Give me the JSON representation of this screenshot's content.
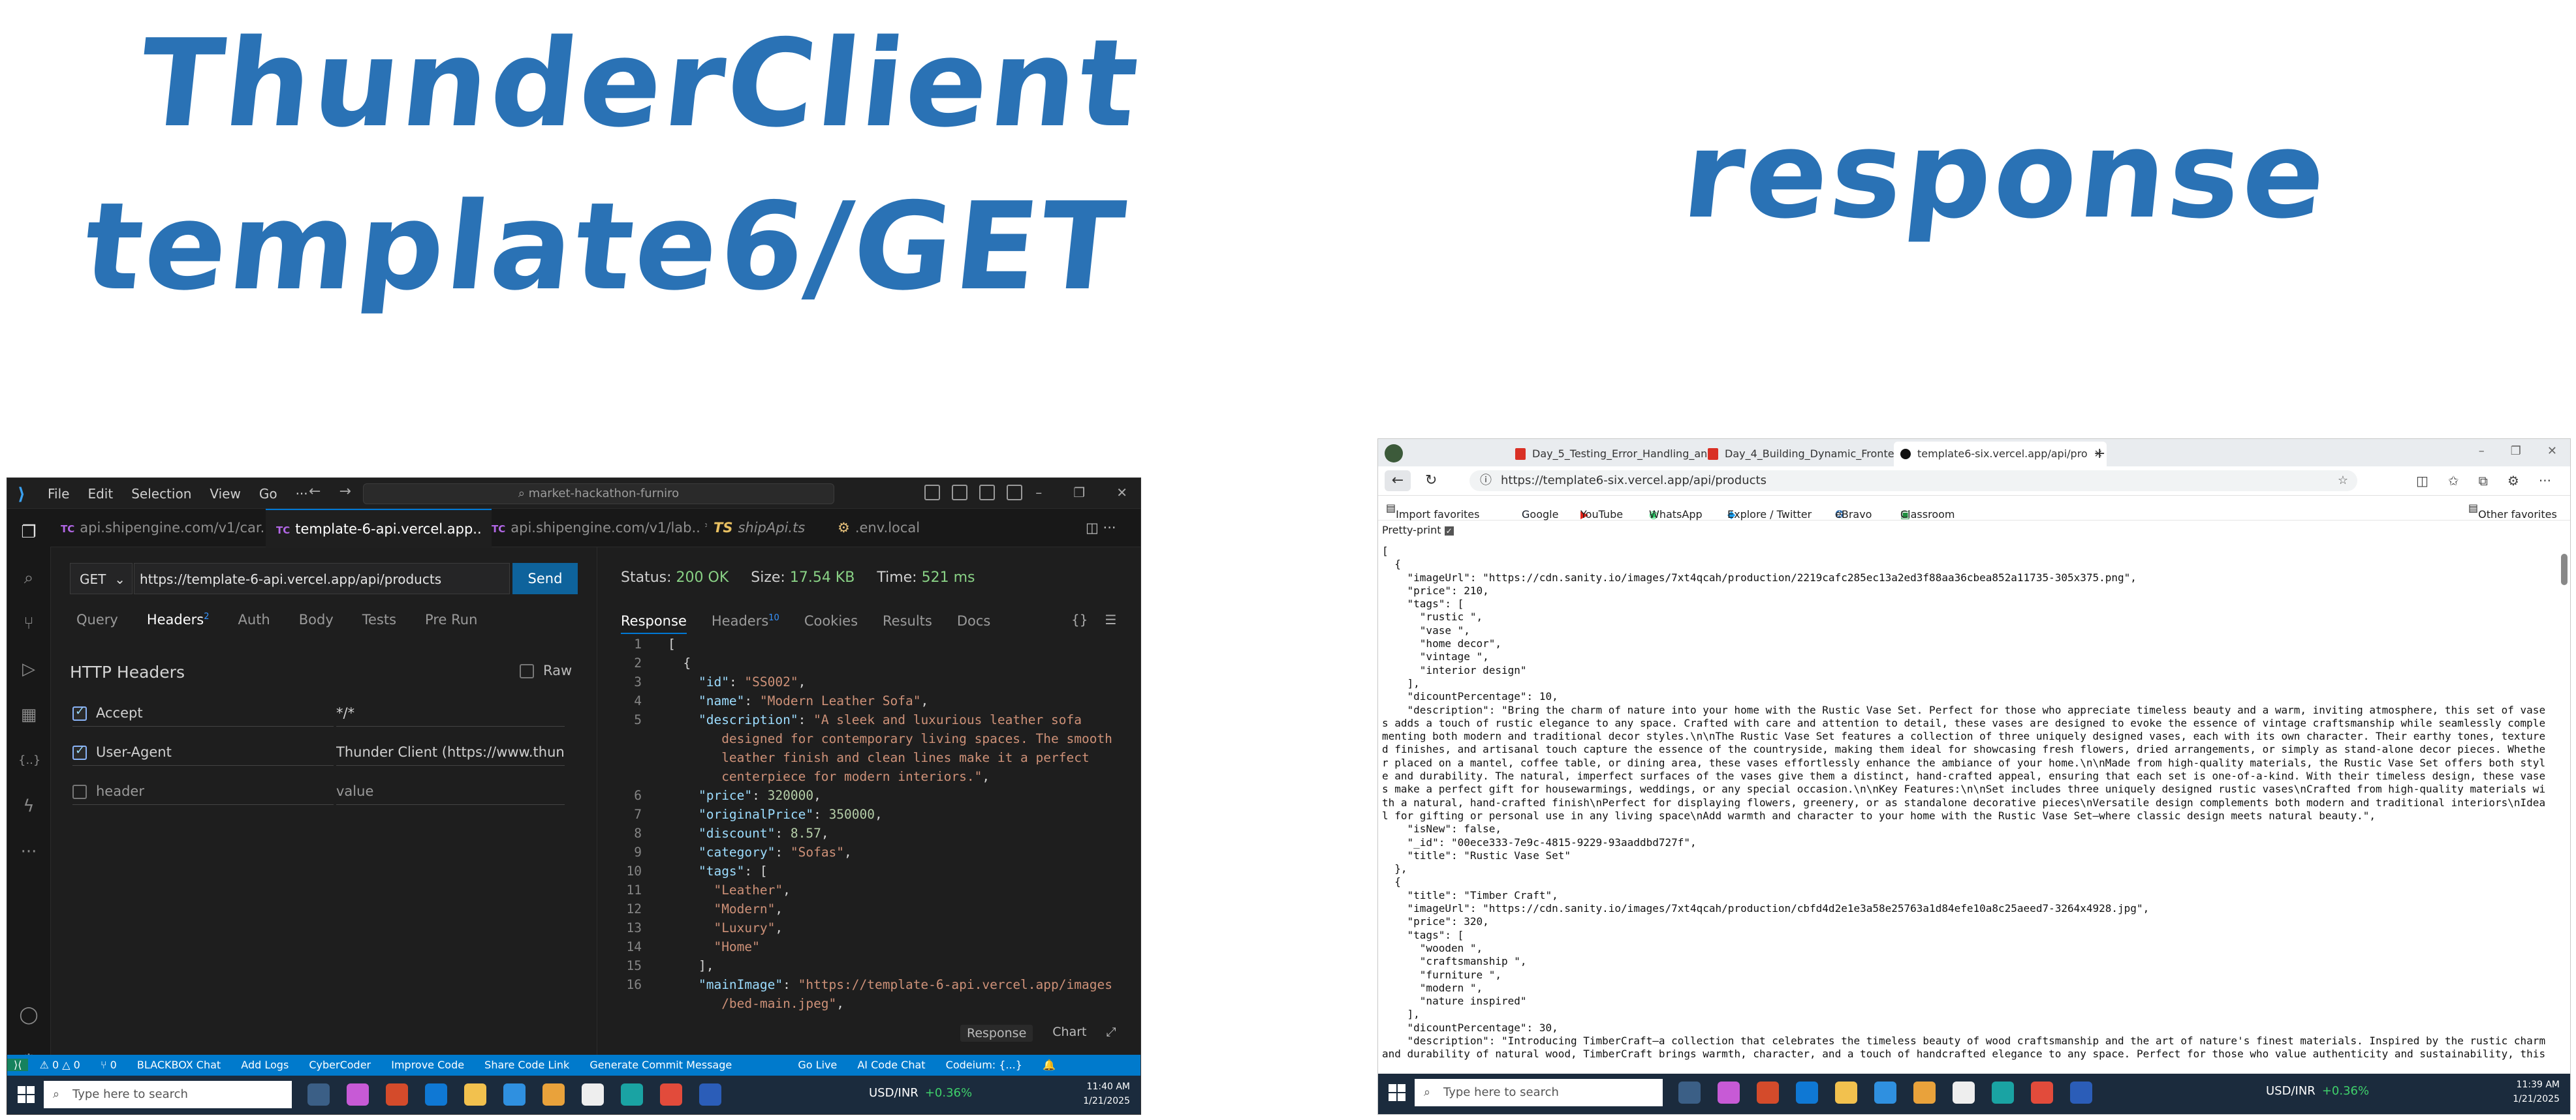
{
  "headings": {
    "left_line1": "ThunderClient",
    "left_line2": "template6/GET",
    "right": "response"
  },
  "vscode": {
    "menu": [
      "File",
      "Edit",
      "Selection",
      "View",
      "Go",
      "···"
    ],
    "search": "market-hackathon-furniro",
    "tabs": [
      {
        "label": "api.shipengine.com/v1/car...",
        "kind": "TC"
      },
      {
        "label": "template-6-api.vercel.app..",
        "kind": "TC",
        "active": true
      },
      {
        "label": "api.shipengine.com/v1/lab.. *",
        "kind": "TC"
      },
      {
        "label": "shipApi.ts",
        "kind": "TS"
      },
      {
        "label": ".env.local",
        "kind": "ENV"
      }
    ],
    "request": {
      "method": "GET",
      "url": "https://template-6-api.vercel.app/api/products",
      "send": "Send",
      "tabs": [
        "Query",
        "Headers",
        "Auth",
        "Body",
        "Tests",
        "Pre Run"
      ],
      "headers_count": "2",
      "section_title": "HTTP Headers",
      "raw_label": "Raw",
      "headers": [
        {
          "checked": true,
          "key": "Accept",
          "value": "*/*"
        },
        {
          "checked": true,
          "key": "User-Agent",
          "value": "Thunder Client (https://www.thunderclient"
        },
        {
          "checked": false,
          "key": "header",
          "value": "value"
        }
      ]
    },
    "response": {
      "status_label": "Status:",
      "status": "200 OK",
      "size_label": "Size:",
      "size": "17.54 KB",
      "time_label": "Time:",
      "time": "521 ms",
      "tabs": [
        "Response",
        "Headers",
        "Cookies",
        "Results",
        "Docs"
      ],
      "headers_count": "10",
      "braces": "{}",
      "footer": [
        "Response",
        "Chart"
      ]
    },
    "statusbar": [
      "⚠ 0 △ 0",
      "⑂ 0",
      "BLACKBOX Chat",
      "Add Logs",
      "CyberCoder",
      "Improve Code",
      "Share Code Link",
      "Generate Commit Message",
      "Go Live",
      "AI Code Chat",
      "Codeium: {...}"
    ],
    "taskbar": {
      "search": "Type here to search",
      "ticker": "USD/INR",
      "ticker_change": "+0.36%",
      "time": "11:40 AM",
      "date": "1/21/2025"
    }
  },
  "code_lines": [
    {
      "n": "1",
      "html": "<span class='pun'>[</span>"
    },
    {
      "n": "2",
      "html": "  <span class='pun'>{</span>"
    },
    {
      "n": "3",
      "html": "    <span class='key'>\"id\"</span>: <span class='str'>\"SS002\"</span>,"
    },
    {
      "n": "4",
      "html": "    <span class='key'>\"name\"</span>: <span class='str'>\"Modern Leather Sofa\"</span>,"
    },
    {
      "n": "5",
      "html": "    <span class='key'>\"description\"</span>: <span class='str'>\"A sleek and luxurious leather sofa</span>"
    },
    {
      "n": "",
      "html": "       <span class='str'>designed for contemporary living spaces. The smooth</span>"
    },
    {
      "n": "",
      "html": "       <span class='str'>leather finish and clean lines make it a perfect</span>"
    },
    {
      "n": "",
      "html": "       <span class='str'>centerpiece for modern interiors.\"</span>,"
    },
    {
      "n": "6",
      "html": "    <span class='key'>\"price\"</span>: <span class='num'>320000</span>,"
    },
    {
      "n": "7",
      "html": "    <span class='key'>\"originalPrice\"</span>: <span class='num'>350000</span>,"
    },
    {
      "n": "8",
      "html": "    <span class='key'>\"discount\"</span>: <span class='num'>8.57</span>,"
    },
    {
      "n": "9",
      "html": "    <span class='key'>\"category\"</span>: <span class='str'>\"Sofas\"</span>,"
    },
    {
      "n": "10",
      "html": "    <span class='key'>\"tags\"</span>: ["
    },
    {
      "n": "11",
      "html": "      <span class='str'>\"Leather\"</span>,"
    },
    {
      "n": "12",
      "html": "      <span class='str'>\"Modern\"</span>,"
    },
    {
      "n": "13",
      "html": "      <span class='str'>\"Luxury\"</span>,"
    },
    {
      "n": "14",
      "html": "      <span class='str'>\"Home\"</span>"
    },
    {
      "n": "15",
      "html": "    ],"
    },
    {
      "n": "16",
      "html": "    <span class='key'>\"mainImage\"</span>: <span class='str'>\"https://template-6-api.vercel.app/images</span>"
    },
    {
      "n": "",
      "html": "       <span class='str'>/bed-main.jpeg\"</span>,"
    }
  ],
  "browser": {
    "tabs": [
      {
        "label": "Day_5_Testing_Error_Handling_an",
        "icon": "pdf"
      },
      {
        "label": "Day_4_Building_Dynamic_Fronten",
        "icon": "pdf"
      },
      {
        "label": "template6-six.vercel.app/api/pro",
        "icon": "vercel",
        "active": true
      }
    ],
    "url": "https://template6-six.vercel.app/api/products",
    "favorites": [
      "Import favorites",
      "Google",
      "YouTube",
      "WhatsApp",
      "Explore / Twitter",
      "eBravo",
      "Classroom",
      "Other favorites"
    ],
    "pretty_print": "Pretty-print",
    "json_text": "[\n  {\n    \"imageUrl\": \"https://cdn.sanity.io/images/7xt4qcah/production/2219cafc285ec13a2ed3f88aa36cbea852a11735-305x375.png\",\n    \"price\": 210,\n    \"tags\": [\n      \"rustic \",\n      \"vase \",\n      \"home decor\",\n      \"vintage \",\n      \"interior design\"\n    ],\n    \"dicountPercentage\": 10,\n    \"description\": \"Bring the charm of nature into your home with the Rustic Vase Set. Perfect for those who appreciate timeless beauty and a warm, inviting atmosphere, this set of vases adds a touch of rustic elegance to any space. Crafted with care and attention to detail, these vases are designed to evoke the essence of vintage craftsmanship while seamlessly complementing both modern and traditional decor styles.\\n\\nThe Rustic Vase Set features a collection of three uniquely designed vases, each with its own character. Their earthy tones, textured finishes, and artisanal touch capture the essence of the countryside, making them ideal for showcasing fresh flowers, dried arrangements, or simply as stand-alone decor pieces. Whether placed on a mantel, coffee table, or dining area, these vases effortlessly enhance the ambiance of your home.\\n\\nMade from high-quality materials, the Rustic Vase Set offers both style and durability. The natural, imperfect surfaces of the vases give them a distinct, hand-crafted appeal, ensuring that each set is one-of-a-kind. With their timeless design, these vases make a perfect gift for housewarmings, weddings, or any special occasion.\\n\\nKey Features:\\n\\nSet includes three uniquely designed rustic vases\\nCrafted from high-quality materials with a natural, hand-crafted finish\\nPerfect for displaying flowers, greenery, or as standalone decorative pieces\\nVersatile design complements both modern and traditional interiors\\nIdeal for gifting or personal use in any living space\\nAdd warmth and character to your home with the Rustic Vase Set—where classic design meets natural beauty.\",\n    \"isNew\": false,\n    \"_id\": \"00ece333-7e9c-4815-9229-93aaddbd727f\",\n    \"title\": \"Rustic Vase Set\"\n  },\n  {\n    \"title\": \"Timber Craft\",\n    \"imageUrl\": \"https://cdn.sanity.io/images/7xt4qcah/production/cbfd4d2e1e3a58e25763a1d84efe10a8c25aeed7-3264x4928.jpg\",\n    \"price\": 320,\n    \"tags\": [\n      \"wooden \",\n      \"craftsmanship \",\n      \"furniture \",\n      \"modern \",\n      \"nature inspired\"\n    ],\n    \"dicountPercentage\": 30,\n    \"description\": \"Introducing TimberCraft—a collection that celebrates the timeless beauty of wood craftsmanship and the art of nature's finest materials. Inspired by the rustic charm and durability of natural wood, TimberCraft brings warmth, character, and a touch of handcrafted elegance to any space. Perfect for those who value authenticity and sustainability, this",
    "taskbar": {
      "search": "Type here to search",
      "ticker": "USD/INR",
      "ticker_change": "+0.36%",
      "time": "11:39 AM",
      "date": "1/21/2025"
    }
  }
}
